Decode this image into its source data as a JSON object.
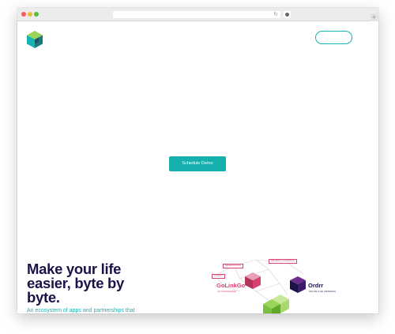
{
  "browser": {
    "reload_icon": "reload-icon",
    "new_tab_glyph": "+"
  },
  "header": {
    "logo_icon": "hexagon-cube-logo",
    "cta_outline_label": ""
  },
  "hero": {
    "cta_label": "Schedule Demo",
    "headline_line1": "Make your life",
    "headline_line2": "easier, byte by",
    "headline_line3": "byte.",
    "subheading": "An ecosystem of apps and partnerships that"
  },
  "ecosystem": {
    "tags": [
      "RESERVATIONS",
      "DELIVERY & LOGISTICS",
      "LOYALTY"
    ],
    "golinkgo_name": "GoLinkGo",
    "golinkgo_sub": "API MIDDLEWARE",
    "ordrr_name": "Ordrr",
    "ordrr_sub": "ONLINE & QR ORDERING"
  },
  "colors": {
    "brand_teal": "#17b3b1",
    "brand_navy": "#1b1249",
    "brand_pink": "#d7436f",
    "accent_green": "#9ad45b"
  }
}
